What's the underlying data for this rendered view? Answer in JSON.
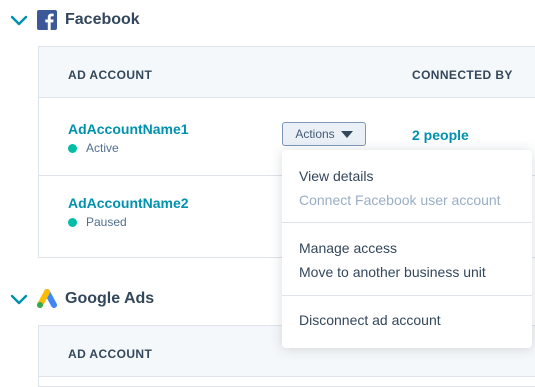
{
  "sections": {
    "facebook": {
      "title": "Facebook",
      "columns": {
        "ad_account": "AD ACCOUNT",
        "connected_by": "CONNECTED BY"
      },
      "rows": [
        {
          "name": "AdAccountName1",
          "status": "Active",
          "actions_label": "Actions",
          "connected_by": "2 people"
        },
        {
          "name": "AdAccountName2",
          "status": "Paused"
        }
      ]
    },
    "google_ads": {
      "title": "Google Ads",
      "columns": {
        "ad_account": "AD ACCOUNT"
      }
    }
  },
  "actions_menu": {
    "items": [
      {
        "label": "View details",
        "enabled": true
      },
      {
        "label": "Connect Facebook user account",
        "enabled": false
      },
      {
        "label": "Manage access",
        "enabled": true
      },
      {
        "label": "Move to another business unit",
        "enabled": true
      },
      {
        "label": "Disconnect ad account",
        "enabled": true
      }
    ]
  },
  "colors": {
    "accent": "#0091ae",
    "status_dot": "#00bda5",
    "facebook_blue": "#3b5998",
    "text_primary": "#33475b",
    "text_disabled": "#99aec4"
  },
  "icons": {
    "collapse": "chevron-down-icon",
    "facebook": "facebook-logo-icon",
    "google_ads": "google-ads-logo-icon",
    "actions": "caret-down-icon"
  }
}
